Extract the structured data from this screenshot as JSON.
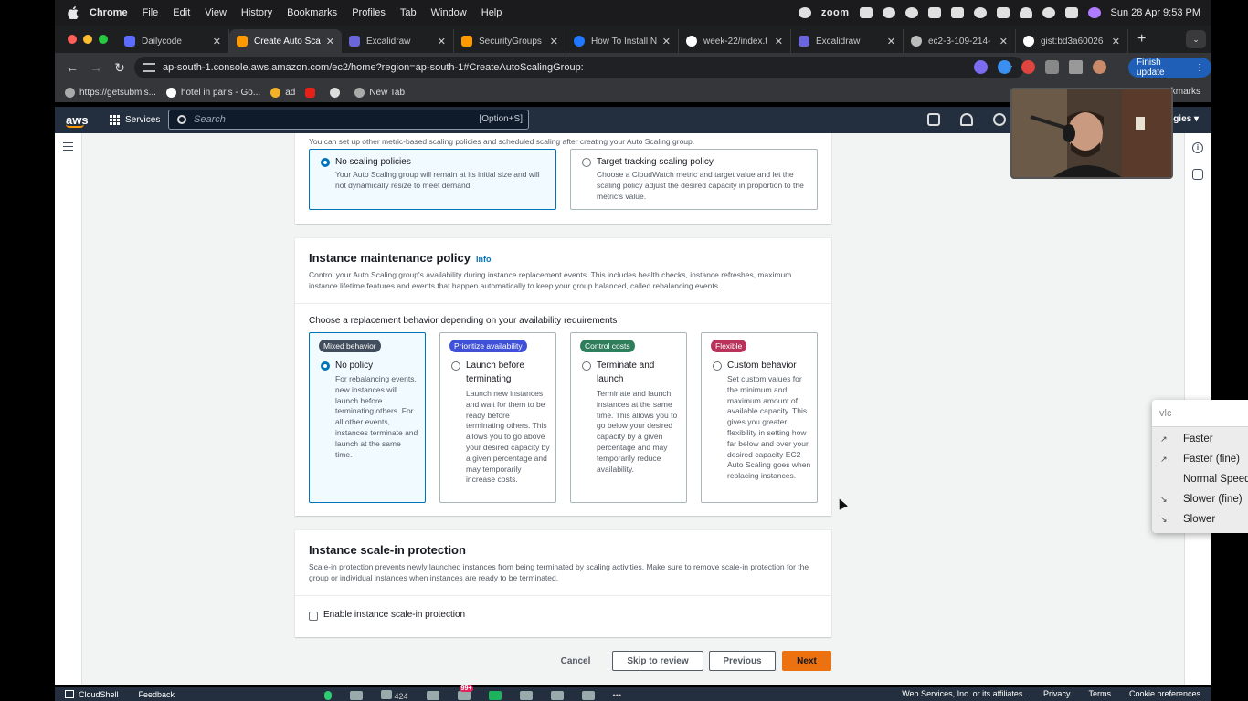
{
  "menubar": {
    "items": [
      "Chrome",
      "File",
      "Edit",
      "View",
      "History",
      "Bookmarks",
      "Profiles",
      "Tab",
      "Window",
      "Help"
    ],
    "zoom_label": "zoom",
    "datetime": "Sun 28 Apr  9:53 PM"
  },
  "tabs": [
    {
      "title": "Dailycode",
      "color": "#5b6cff"
    },
    {
      "title": "Create Auto Scal",
      "color": "#ff9900"
    },
    {
      "title": "Excalidraw",
      "color": "#6965db"
    },
    {
      "title": "SecurityGroups |",
      "color": "#ff9900"
    },
    {
      "title": "How To Install N",
      "color": "#1f78ff"
    },
    {
      "title": "week-22/index.t",
      "color": "#ffffff"
    },
    {
      "title": "Excalidraw",
      "color": "#6965db"
    },
    {
      "title": "ec2-3-109-214-",
      "color": "#bbbbbb"
    },
    {
      "title": "gist:bd3a60026",
      "color": "#ffffff"
    }
  ],
  "address": {
    "url": "ap-south-1.console.aws.amazon.com/ec2/home?region=ap-south-1#CreateAutoScalingGroup:",
    "finish_update": "Finish update"
  },
  "bookmarks": {
    "items": [
      "https://getsubmis...",
      "hotel in paris - Go...",
      "ad",
      "",
      "",
      "New Tab"
    ],
    "right": "kmarks"
  },
  "awsnav": {
    "logo": "aws",
    "services": "Services",
    "search_placeholder": "Search",
    "shortcut": "[Option+S]",
    "account": "gies ▾"
  },
  "scaling_policies": {
    "intro": "You can set up other metric-based scaling policies and scheduled scaling after creating your Auto Scaling group.",
    "options": [
      {
        "title": "No scaling policies",
        "text": "Your Auto Scaling group will remain at its initial size and will not dynamically resize to meet demand.",
        "selected": true
      },
      {
        "title": "Target tracking scaling policy",
        "text": "Choose a CloudWatch metric and target value and let the scaling policy adjust the desired capacity in proportion to the metric's value.",
        "selected": false
      }
    ]
  },
  "maintenance": {
    "title": "Instance maintenance policy",
    "info": "Info",
    "desc": "Control your Auto Scaling group's availability during instance replacement events. This includes health checks, instance refreshes, maximum instance lifetime features and events that happen automatically to keep your group balanced, called rebalancing events.",
    "choose_label": "Choose a replacement behavior depending on your availability requirements",
    "options": [
      {
        "badge": "Mixed behavior",
        "badge_color": "#414d5c",
        "title": "No policy",
        "text": "For rebalancing events, new instances will launch before terminating others. For all other events, instances terminate and launch at the same time.",
        "selected": true
      },
      {
        "badge": "Prioritize availability",
        "badge_color": "#3f51d8",
        "title": "Launch before terminating",
        "text": "Launch new instances and wait for them to be ready before terminating others. This allows you to go above your desired capacity by a given percentage and may temporarily increase costs.",
        "selected": false
      },
      {
        "badge": "Control costs",
        "badge_color": "#2e7d5b",
        "title": "Terminate and launch",
        "text": "Terminate and launch instances at the same time. This allows you to go below your desired capacity by a given percentage and may temporarily reduce availability.",
        "selected": false
      },
      {
        "badge": "Flexible",
        "badge_color": "#b8325a",
        "title": "Custom behavior",
        "text": "Set custom values for the minimum and maximum amount of available capacity. This gives you greater flexibility in setting how far below and over your desired capacity EC2 Auto Scaling goes when replacing instances.",
        "selected": false
      }
    ]
  },
  "scalein": {
    "title": "Instance scale-in protection",
    "desc": "Scale-in protection prevents newly launched instances from being terminated by scaling activities. Make sure to remove scale-in protection for the group or individual instances when instances are ready to be terminated.",
    "checkbox_label": "Enable instance scale-in protection",
    "checked": false
  },
  "actions": {
    "cancel": "Cancel",
    "skip": "Skip to review",
    "previous": "Previous",
    "next": "Next"
  },
  "footer": {
    "cloudshell": "CloudShell",
    "feedback": "Feedback",
    "copyright": "Web Services, Inc. or its affiliates.",
    "privacy": "Privacy",
    "terms": "Terms",
    "cookies": "Cookie preferences",
    "participants": "424",
    "chat_badge": "99+"
  },
  "vlc": {
    "input": "vlc",
    "items": [
      {
        "label": "Faster",
        "icon": "↗"
      },
      {
        "label": "Faster (fine)",
        "icon": "↗"
      },
      {
        "label": "Normal Speed",
        "icon": ""
      },
      {
        "label": "Slower (fine)",
        "icon": "↘"
      },
      {
        "label": "Slower",
        "icon": "↘"
      }
    ]
  }
}
